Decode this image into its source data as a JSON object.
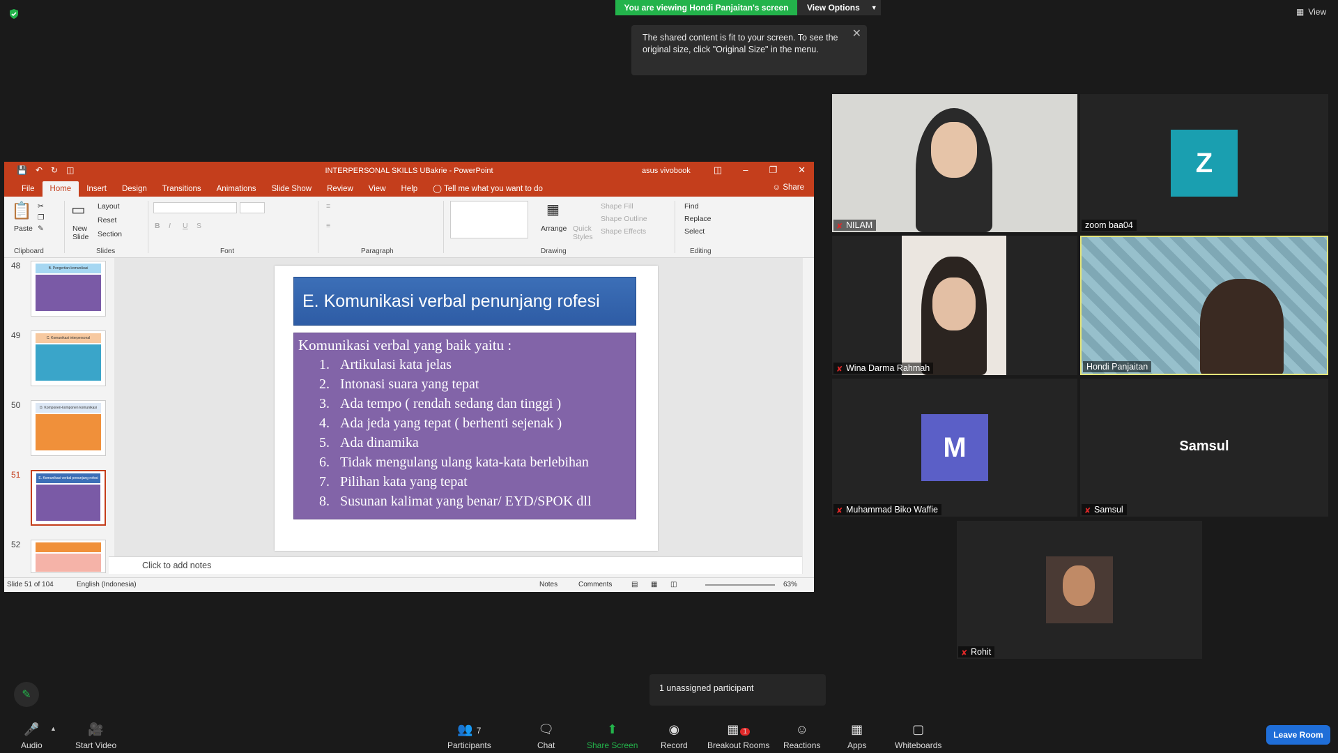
{
  "zoom_top": {
    "banner": "You are viewing Hondi Panjaitan's screen",
    "view_options": "View Options",
    "view": "View",
    "tooltip": "The shared content is fit to your screen. To see the original size, click \"Original Size\" in the menu."
  },
  "ppt": {
    "title": "INTERPERSONAL SKILLS UBakrie - PowerPoint",
    "user": "asus vivobook",
    "tabs": [
      "File",
      "Home",
      "Insert",
      "Design",
      "Transitions",
      "Animations",
      "Slide Show",
      "Review",
      "View",
      "Help"
    ],
    "tell_me": "Tell me what you want to do",
    "share": "Share",
    "ribbon": {
      "paste": "Paste",
      "clipboard": "Clipboard",
      "new_slide": "New Slide",
      "layout": "Layout",
      "reset": "Reset",
      "section": "Section",
      "slides": "Slides",
      "font": "Font",
      "paragraph": "Paragraph",
      "arrange": "Arrange",
      "quick_styles": "Quick Styles",
      "shape_fill": "Shape Fill",
      "shape_outline": "Shape Outline",
      "shape_effects": "Shape Effects",
      "drawing": "Drawing",
      "find": "Find",
      "replace": "Replace",
      "select": "Select",
      "editing": "Editing"
    },
    "thumbnails": [
      {
        "num": "48",
        "title": "B. Pengertian komunikasi",
        "color": "#7a5aa6",
        "selected": false
      },
      {
        "num": "49",
        "title": "C. Komunikasi interpersonal",
        "color": "#3aa5c9",
        "selected": false
      },
      {
        "num": "50",
        "title": "D. Komponen-komponen komunikasi",
        "color": "#f0903a",
        "selected": false
      },
      {
        "num": "51",
        "title": "E. Komunikasi verbal penunjang rofesi",
        "color": "#7a5aa6",
        "selected": true
      },
      {
        "num": "52",
        "title": "",
        "color": "#f5b3a8",
        "selected": false
      }
    ],
    "slide": {
      "title": "E. Komunikasi verbal penunjang rofesi",
      "lead": "Komunikasi verbal yang baik yaitu :",
      "items": [
        "Artikulasi kata jelas",
        "Intonasi suara yang tepat",
        "Ada tempo ( rendah sedang dan tinggi )",
        "Ada jeda yang tepat ( berhenti sejenak )",
        "Ada dinamika",
        "Tidak mengulang ulang kata-kata berlebihan",
        "Pilihan kata yang tepat",
        "Susunan kalimat yang benar/ EYD/SPOK dll"
      ]
    },
    "notes_placeholder": "Click to add notes",
    "status": {
      "slide": "Slide 51 of 104",
      "language": "English (Indonesia)",
      "notes": "Notes",
      "comments": "Comments",
      "zoom": "63%"
    }
  },
  "participants": [
    {
      "name": "NILAM",
      "muted": true
    },
    {
      "name": "zoom baa04",
      "avatar_letter": "Z",
      "avatar_color": "#1a9fb0"
    },
    {
      "name": "Wina Darma Rahmah",
      "muted": true
    },
    {
      "name": "Hondi Panjaitan",
      "active_speaker": true
    },
    {
      "name": "Muhammad Biko Waffie",
      "avatar_letter": "M",
      "avatar_color": "#5b5fc7",
      "muted": true
    },
    {
      "name": "Samsul",
      "display_name": "Samsul",
      "muted": true
    },
    {
      "name": "Rohit",
      "muted": true
    }
  ],
  "toolbar": {
    "audio": "Audio",
    "start_video": "Start Video",
    "participants": "Participants",
    "participants_count": "7",
    "chat": "Chat",
    "share_screen": "Share Screen",
    "record": "Record",
    "breakout_rooms": "Breakout Rooms",
    "breakout_badge": "1",
    "reactions": "Reactions",
    "apps": "Apps",
    "whiteboards": "Whiteboards",
    "leave": "Leave Room",
    "unassigned": "1 unassigned participant"
  }
}
